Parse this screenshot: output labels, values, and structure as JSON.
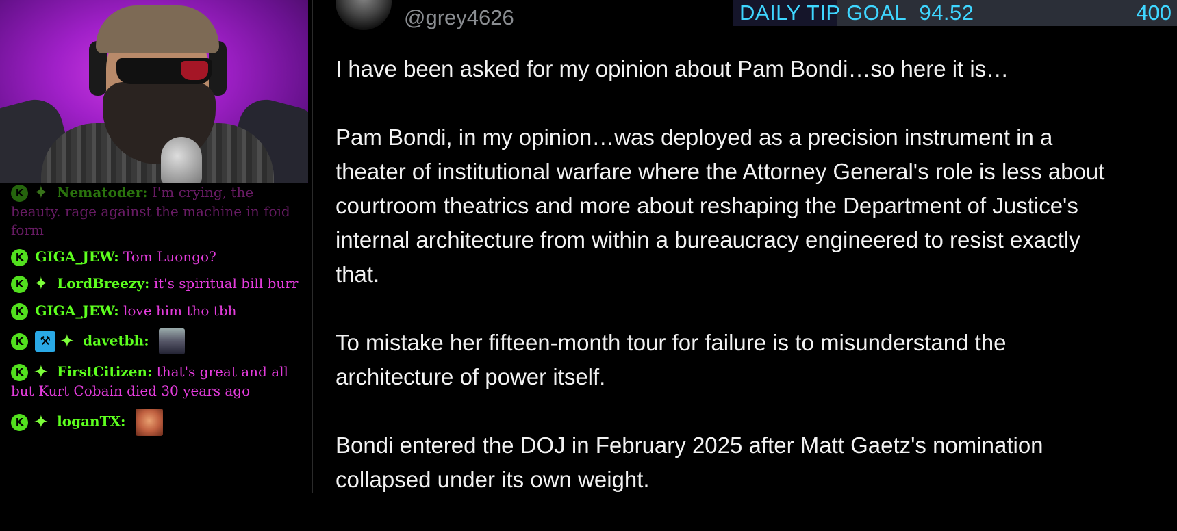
{
  "chat": {
    "messages": [
      {
        "user": "Nematoder:",
        "text": "I'm crying, the beauty. rage against the machine in foid form",
        "badges": [
          "k",
          "star"
        ],
        "faded": true
      },
      {
        "user": "GIGA_JEW:",
        "text": "Tom Luongo?",
        "badges": [
          "k"
        ]
      },
      {
        "user": "LordBreezy:",
        "text": "it's spiritual bill burr",
        "badges": [
          "k",
          "star"
        ]
      },
      {
        "user": "GIGA_JEW:",
        "text": "love him tho tbh",
        "badges": [
          "k"
        ]
      },
      {
        "user": "davetbh:",
        "text": "",
        "badges": [
          "k",
          "mod",
          "star"
        ],
        "emote": "portrait"
      },
      {
        "user": "FirstCitizen:",
        "text": "that's great and all but Kurt Cobain died 30 years ago",
        "badges": [
          "k",
          "star"
        ]
      },
      {
        "user": "loganTX:",
        "text": "",
        "badges": [
          "k",
          "star"
        ],
        "emote": "face"
      }
    ],
    "badge_letter": "K",
    "colors": {
      "username": "#5dff1e",
      "text": "#e43cdc",
      "badge": "#52e01e"
    }
  },
  "post": {
    "handle": "@grey4626",
    "paragraphs": [
      "I have been asked for my opinion about Pam Bondi…so here it is…",
      "Pam Bondi, in my opinion…was deployed as a precision instrument in a theater of institutional warfare where the Attorney General's role is less about courtroom theatrics and more about reshaping the Department of Justice's internal architecture from within a bureaucracy engineered to resist exactly that.",
      "To mistake her fifteen-month tour for failure is to misunderstand the architecture of power itself.",
      "Bondi entered the DOJ in February 2025 after Matt Gaetz's nomination collapsed under its own weight."
    ]
  },
  "tip_goal": {
    "label": "DAILY TIP GOAL",
    "current": "94.52",
    "max": "400",
    "progress": 0.2363,
    "color": "#3fd6ff"
  }
}
